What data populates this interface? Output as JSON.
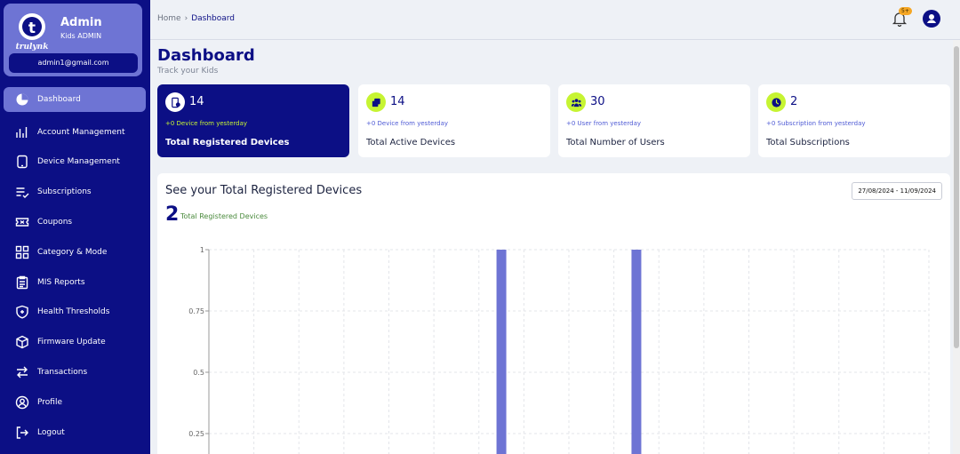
{
  "user": {
    "name": "Admin",
    "role": "Kids ADMIN",
    "email": "admin1@gmail.com",
    "logo_text": "trulynk"
  },
  "sidebar": {
    "items": [
      {
        "label": "Dashboard",
        "icon": "pie-chart-icon",
        "active": true
      },
      {
        "label": "Account Management",
        "icon": "bar-chart-icon"
      },
      {
        "label": "Device Management",
        "icon": "tablet-icon"
      },
      {
        "label": "Subscriptions",
        "icon": "list-check-icon"
      },
      {
        "label": "Coupons",
        "icon": "ticket-icon"
      },
      {
        "label": "Category & Mode",
        "icon": "grid-icon"
      },
      {
        "label": "MIS Reports",
        "icon": "clipboard-icon"
      },
      {
        "label": "Health Thresholds",
        "icon": "shield-icon"
      },
      {
        "label": "Firmware Update",
        "icon": "box-icon"
      },
      {
        "label": "Transactions",
        "icon": "arrows-icon"
      },
      {
        "label": "Profile",
        "icon": "user-icon"
      },
      {
        "label": "Logout",
        "icon": "logout-icon"
      }
    ]
  },
  "breadcrumb": {
    "home": "Home",
    "separator": "›",
    "current": "Dashboard"
  },
  "notifications": {
    "badge": "5+"
  },
  "page": {
    "title": "Dashboard",
    "subtitle": "Track your Kids"
  },
  "cards": [
    {
      "value": "14",
      "delta": "+0 Device from yesterday",
      "label": "Total Registered Devices",
      "icon": "device-icon"
    },
    {
      "value": "14",
      "delta": "+0 Device from yesterday",
      "label": "Total Active Devices",
      "icon": "devices-icon"
    },
    {
      "value": "30",
      "delta": "+0 User from yesterday",
      "label": "Total Number of Users",
      "icon": "users-icon"
    },
    {
      "value": "2",
      "delta": "+0 Subscription from yesterday",
      "label": "Total Subscriptions",
      "icon": "clock-icon"
    }
  ],
  "panel": {
    "title": "See your Total Registered Devices",
    "date_range": "27/08/2024 - 11/09/2024",
    "total": "2",
    "total_label": "Total Registered Devices"
  },
  "colors": {
    "primary": "#0c0f85",
    "accent": "#6e74d4",
    "lime": "#c6f432"
  },
  "chart_data": {
    "type": "bar",
    "ylim": [
      0,
      1
    ],
    "y_ticks": [
      "1",
      "0.75",
      "0.5",
      "0.25"
    ],
    "categories": [
      "",
      "",
      "",
      "",
      "",
      "",
      "",
      "",
      "",
      "",
      "",
      "",
      "",
      "",
      "",
      ""
    ],
    "values": [
      0,
      0,
      0,
      0,
      0,
      0,
      1,
      0,
      0,
      1,
      0,
      0,
      0,
      0,
      0,
      0
    ]
  }
}
